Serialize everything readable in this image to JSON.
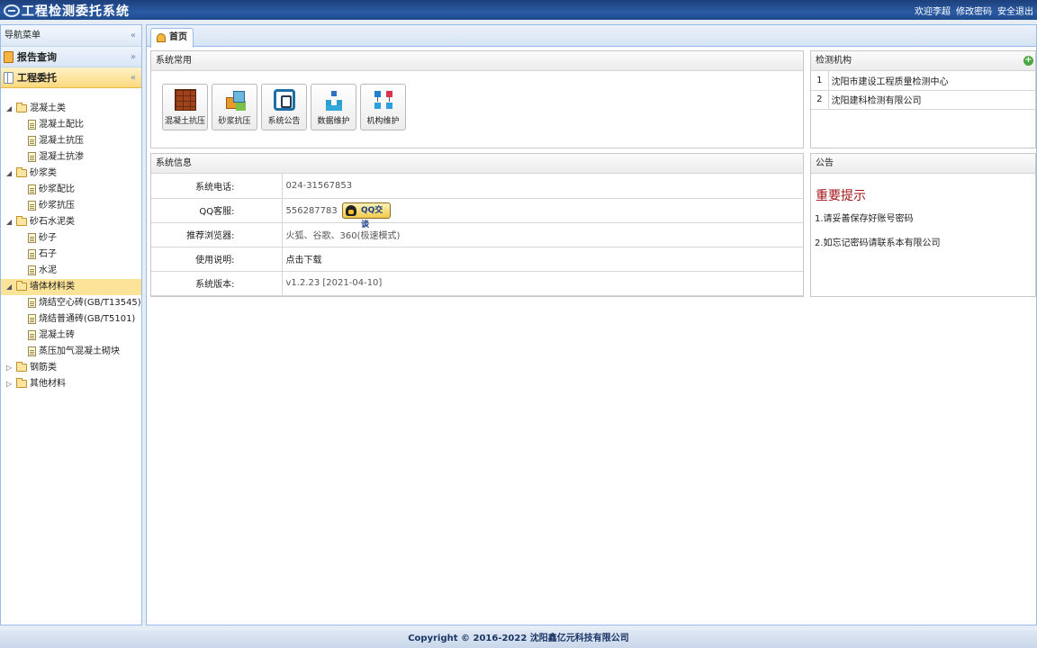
{
  "header": {
    "title": "工程检测委托系统",
    "links": [
      "欢迎李超",
      "修改密码",
      "安全退出"
    ]
  },
  "sidebar": {
    "nav_title": "导航菜单",
    "nav_collapse": "«",
    "tabs": [
      {
        "label": "报告查询",
        "chevron": "»"
      },
      {
        "label": "工程委托",
        "chevron": "«"
      }
    ],
    "tree": [
      {
        "label": "混凝土类",
        "level": 0,
        "kind": "folder",
        "expanded": true
      },
      {
        "label": "混凝土配比",
        "level": 1,
        "kind": "doc"
      },
      {
        "label": "混凝土抗压",
        "level": 1,
        "kind": "doc"
      },
      {
        "label": "混凝土抗渗",
        "level": 1,
        "kind": "doc"
      },
      {
        "label": "砂浆类",
        "level": 0,
        "kind": "folder",
        "expanded": true
      },
      {
        "label": "砂浆配比",
        "level": 1,
        "kind": "doc"
      },
      {
        "label": "砂浆抗压",
        "level": 1,
        "kind": "doc"
      },
      {
        "label": "砂石水泥类",
        "level": 0,
        "kind": "folder",
        "expanded": true
      },
      {
        "label": "砂子",
        "level": 1,
        "kind": "doc"
      },
      {
        "label": "石子",
        "level": 1,
        "kind": "doc"
      },
      {
        "label": "水泥",
        "level": 1,
        "kind": "doc"
      },
      {
        "label": "墙体材料类",
        "level": 0,
        "kind": "folder",
        "expanded": true,
        "selected": true
      },
      {
        "label": "烧结空心砖(GB/T13545)",
        "level": 1,
        "kind": "doc"
      },
      {
        "label": "烧结普通砖(GB/T5101)",
        "level": 1,
        "kind": "doc"
      },
      {
        "label": "混凝土砖",
        "level": 1,
        "kind": "doc"
      },
      {
        "label": "蒸压加气混凝土砌块",
        "level": 1,
        "kind": "doc"
      },
      {
        "label": "钢筋类",
        "level": 0,
        "kind": "folder",
        "expanded": false
      },
      {
        "label": "其他材料",
        "level": 0,
        "kind": "folder",
        "expanded": false
      }
    ]
  },
  "main": {
    "tab_label": "首页",
    "common": {
      "title": "系统常用",
      "shortcuts": [
        {
          "label": "混凝土抗压",
          "icon": "brick-icon"
        },
        {
          "label": "砂浆抗压",
          "icon": "cubes-icon"
        },
        {
          "label": "系统公告",
          "icon": "frame-icon"
        },
        {
          "label": "数据维护",
          "icon": "blocks-icon"
        },
        {
          "label": "机构维护",
          "icon": "network-icon"
        }
      ]
    },
    "orgs": {
      "title": "检测机构",
      "add": "+",
      "rows": [
        {
          "no": "1",
          "name": "沈阳市建设工程质量检测中心"
        },
        {
          "no": "2",
          "name": "沈阳建科检测有限公司"
        }
      ]
    },
    "sysinfo": {
      "title": "系统信息",
      "rows": [
        {
          "key": "系统电话:",
          "value": "024-31567853"
        },
        {
          "key": "QQ客服:",
          "value": "556287783",
          "button": "QQ交谈"
        },
        {
          "key": "推荐浏览器:",
          "value": "火狐、谷歌、360(极速模式)"
        },
        {
          "key": "使用说明:",
          "value": "点击下载"
        },
        {
          "key": "系统版本:",
          "value": "v1.2.23 [2021-04-10]"
        }
      ]
    },
    "notice": {
      "title": "公告",
      "heading": "重要提示",
      "lines": [
        "1.请妥善保存好账号密码",
        "2.如忘记密码请联系本有限公司"
      ]
    }
  },
  "footer": "Copyright © 2016-2022 沈阳鑫亿元科技有限公司"
}
